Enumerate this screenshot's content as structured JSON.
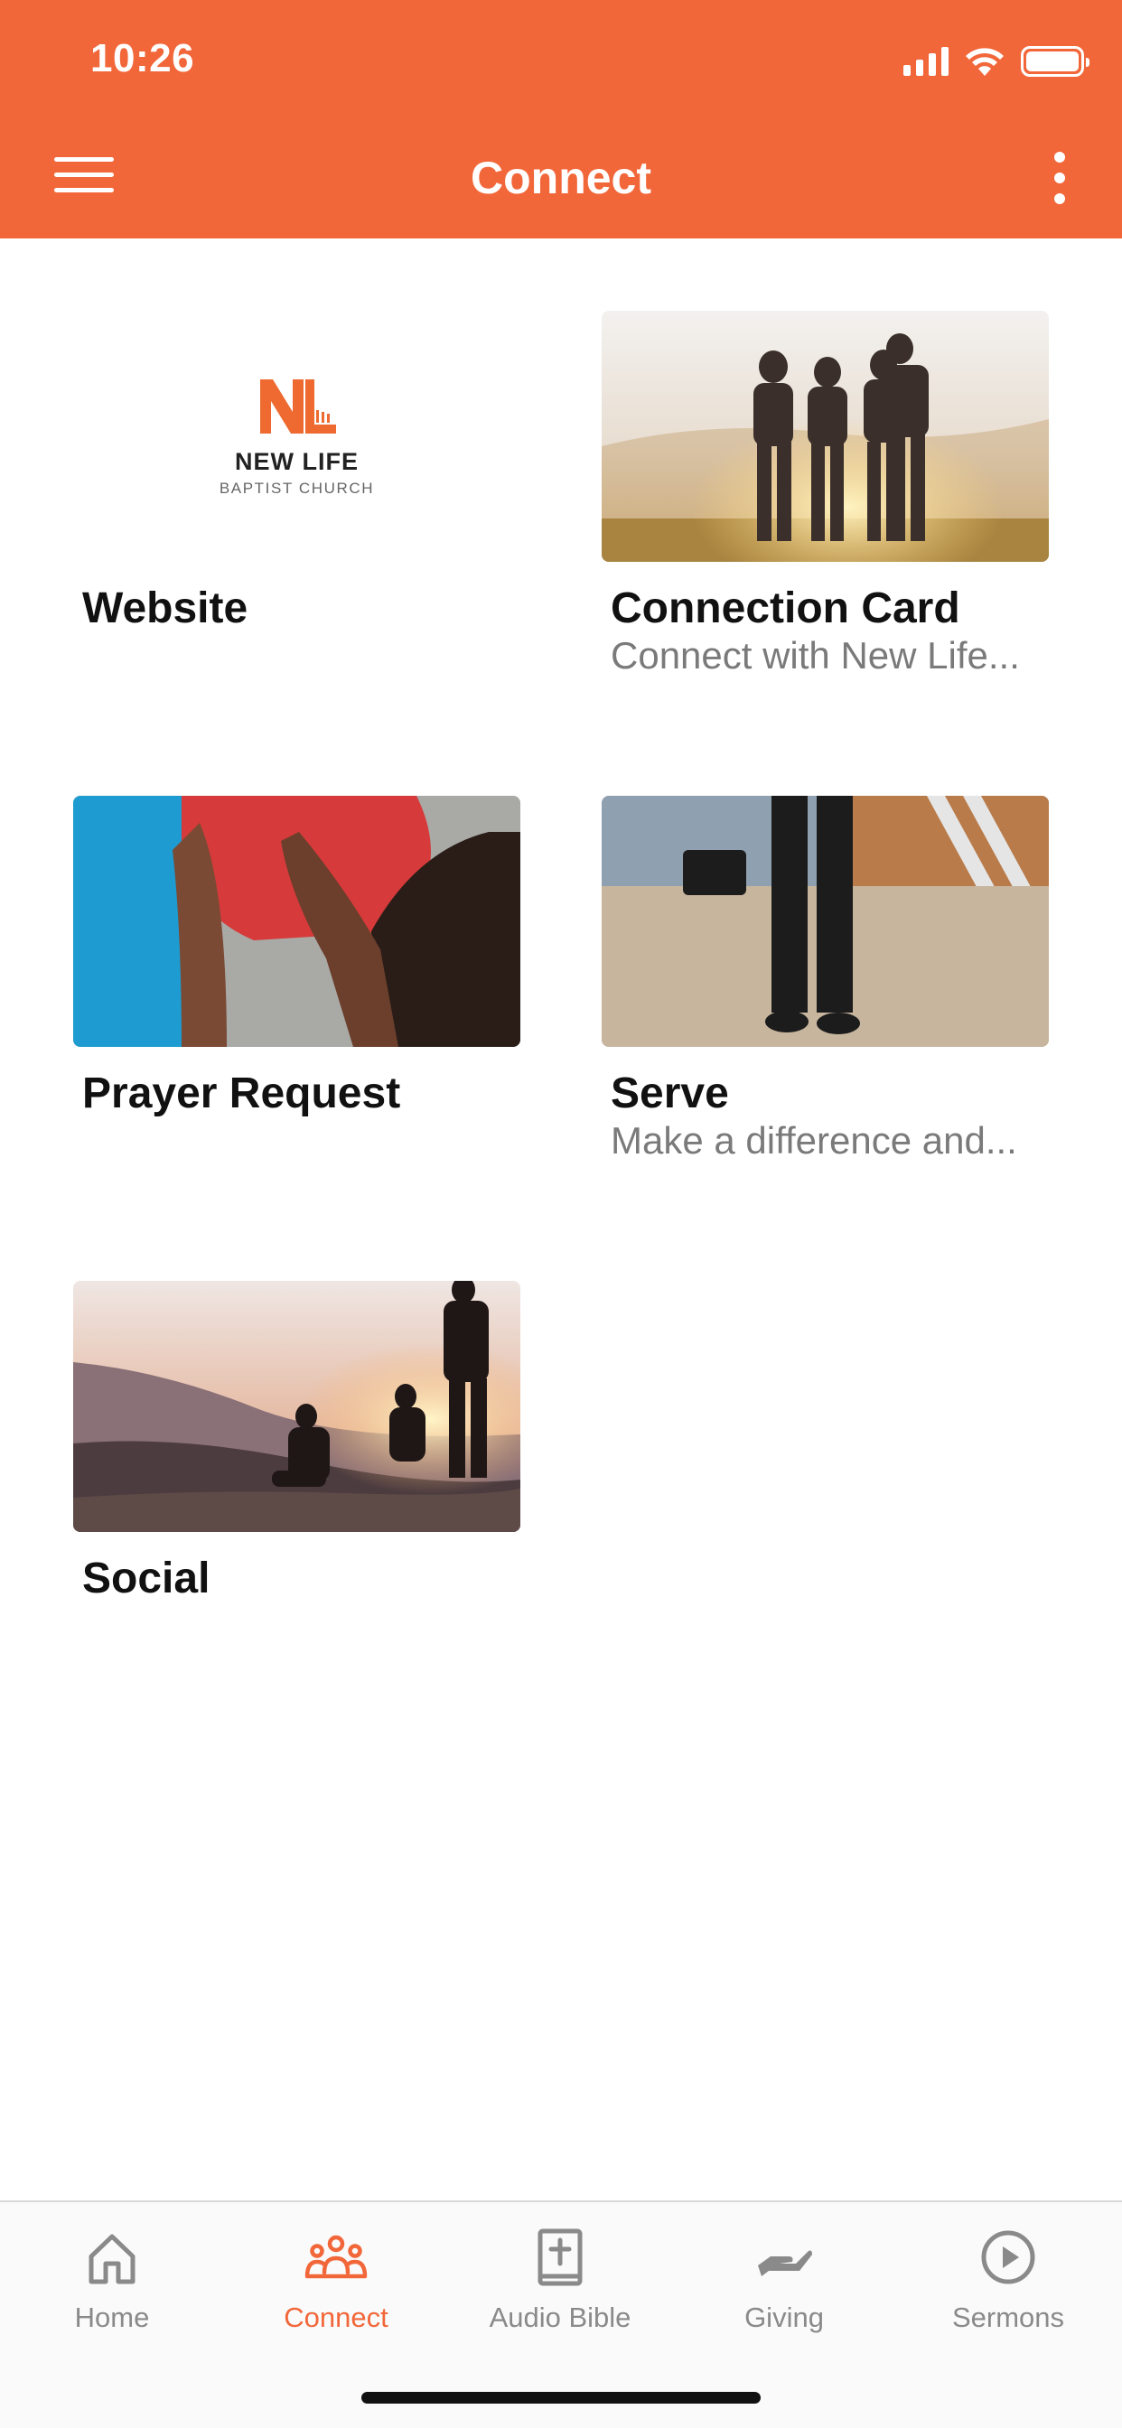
{
  "status_bar": {
    "time": "10:26"
  },
  "header": {
    "title": "Connect",
    "background": "#f2673a"
  },
  "tiles": [
    {
      "label": "Website",
      "subtitle": "",
      "image": "new-life-logo",
      "logo_name": "NEW LIFE",
      "logo_sub": "BAPTIST CHURCH"
    },
    {
      "label": "Connection Card",
      "subtitle": "Connect with New Life...",
      "image": "friends-sunset-photo"
    },
    {
      "label": "Prayer Request",
      "subtitle": "",
      "image": "hands-high-five-photo"
    },
    {
      "label": "Serve",
      "subtitle": "Make a difference and...",
      "image": "person-standing-sand-photo"
    },
    {
      "label": "Social",
      "subtitle": "",
      "image": "people-sunset-mountains-photo"
    }
  ],
  "tabbar": {
    "active": "Connect",
    "accent": "#f2673a",
    "items": [
      {
        "label": "Home",
        "icon": "house-icon"
      },
      {
        "label": "Connect",
        "icon": "people-group-icon"
      },
      {
        "label": "Audio Bible",
        "icon": "bible-cross-icon"
      },
      {
        "label": "Giving",
        "icon": "giving-hand-icon"
      },
      {
        "label": "Sermons",
        "icon": "play-circle-icon"
      }
    ]
  }
}
